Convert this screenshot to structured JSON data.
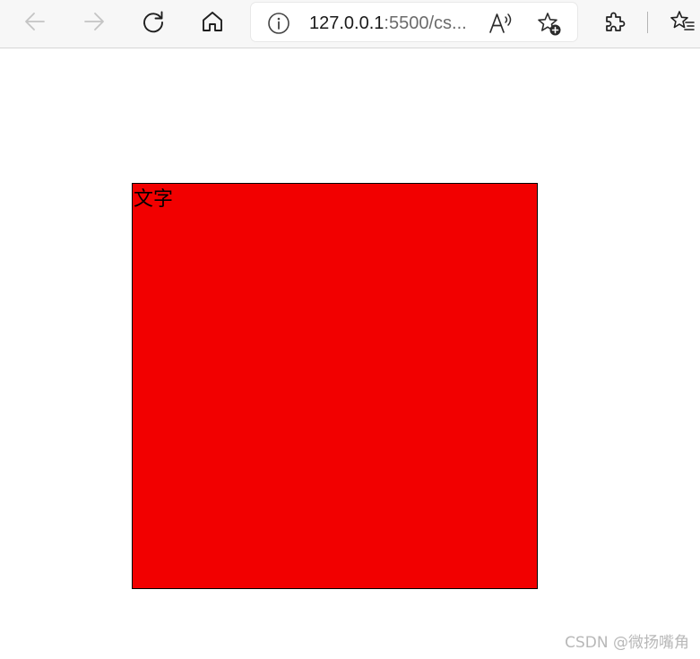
{
  "browser": {
    "toolbar": {
      "back_icon": "arrow-left-icon",
      "forward_icon": "arrow-right-icon",
      "refresh_icon": "refresh-icon",
      "home_icon": "home-icon",
      "extensions_icon": "puzzle-icon",
      "favorites_icon": "favorites-list-icon",
      "background_color": "#f7f7f7"
    },
    "address_bar": {
      "site_info_icon": "info-circle-icon",
      "url_host": "127.0.0.1",
      "url_path": ":5500/cs...",
      "read_aloud_icon": "read-aloud-icon",
      "add_favorite_icon": "star-add-icon"
    }
  },
  "page": {
    "background_color": "#ffffff",
    "box": {
      "text": "文字",
      "background_color": "#f20000",
      "border_color": "#000000"
    },
    "watermark": "CSDN @微扬嘴角"
  }
}
